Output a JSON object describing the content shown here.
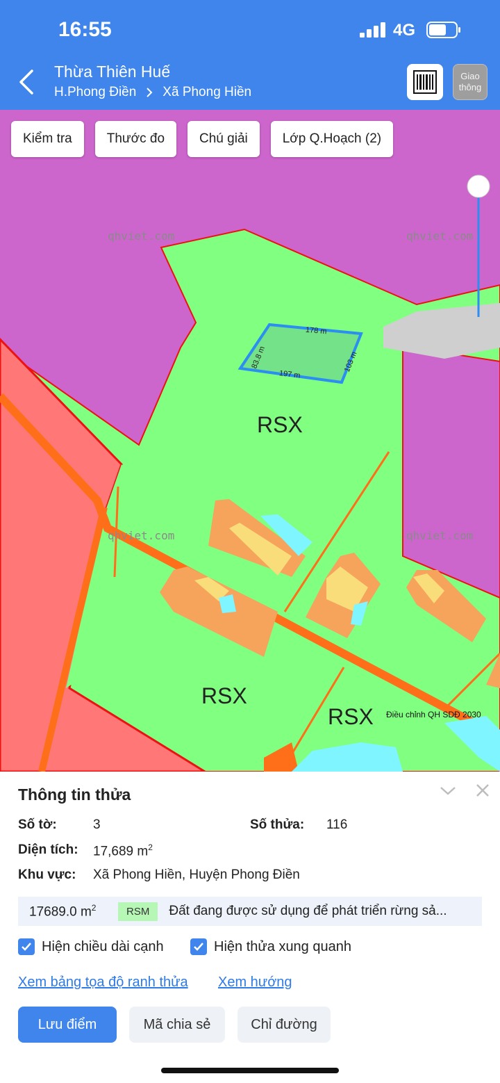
{
  "status_bar": {
    "time": "16:55",
    "network": "4G"
  },
  "header": {
    "title": "Thừa Thiên Huế",
    "breadcrumb": [
      "H.Phong Điền",
      "Xã Phong Hiền"
    ],
    "traffic_button": [
      "Giao",
      "thông"
    ]
  },
  "toolbar": {
    "check_label": "Kiểm tra",
    "measure_label": "Thước đo",
    "legend_label": "Chú giải",
    "layer_label": "Lớp Q.Hoạch (2)"
  },
  "map": {
    "watermark": "qhviet.com",
    "zone_labels": [
      "RSX",
      "RSX",
      "RSX"
    ],
    "plan_note": "Điều chỉnh QH SDĐ 2030",
    "edge_lengths": {
      "top": "178 m",
      "right": "103 m",
      "bottom": "197 m",
      "left": "83.8 m"
    },
    "colors": {
      "purple": "#cc66cc",
      "green": "#80ff80",
      "red_zone": "#ff7777",
      "road": "#ff7722",
      "boundary": "#ee1111",
      "parcel": "#2b8ef0"
    }
  },
  "panel": {
    "title": "Thông tin thửa",
    "sheet_label": "Số tờ:",
    "sheet_value": "3",
    "parcel_label": "Số thửa:",
    "parcel_value": "116",
    "area_label": "Diện tích:",
    "area_value": "17,689 m",
    "area_unit_exp": "2",
    "region_label": "Khu vực:",
    "region_value": "Xã Phong Hiền, Huyện Phong Điền",
    "summary_area": "17689.0 m",
    "summary_area_exp": "2",
    "land_code": "RSM",
    "land_desc": "Đất đang được sử dụng để phát triển rừng sả...",
    "check_edges": "Hiện chiều dài cạnh",
    "check_neighbors": "Hiện thửa xung quanh",
    "link_coords": "Xem bảng tọa độ ranh thửa",
    "link_direction": "Xem hướng",
    "btn_save": "Lưu điểm",
    "btn_share": "Mã chia sẻ",
    "btn_route": "Chỉ đường"
  }
}
